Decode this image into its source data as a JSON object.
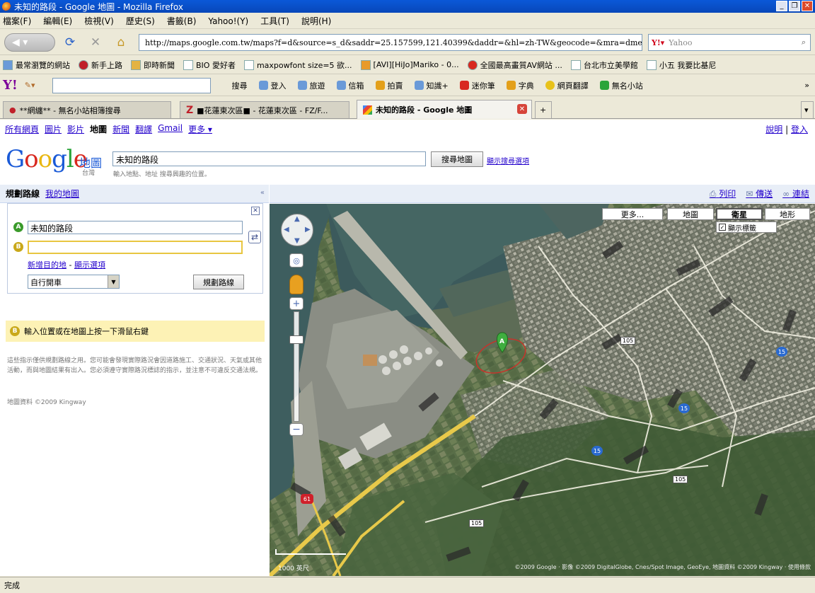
{
  "window": {
    "title": "未知的路段 - Google 地圖 - Mozilla Firefox"
  },
  "menu": [
    "檔案(F)",
    "編輯(E)",
    "檢視(V)",
    "歷史(S)",
    "書籤(B)",
    "Yahoo!(Y)",
    "工具(T)",
    "說明(H)"
  ],
  "nav": {
    "back_label": "◀ ▾",
    "url": "http://maps.google.com.tw/maps?f=d&source=s_d&saddr=25.157599,121.40399&daddr=&hl=zh-TW&geocode=&mra=dme&mrsp=0&sz",
    "search_placeholder": "Yahoo"
  },
  "bookmarks": [
    "最常瀏覽的網站",
    "新手上路",
    "即時新聞",
    "BIO 愛好者",
    "maxpowfont size=5 欲...",
    "[AVI][HiJo]Mariko - 0...",
    "全國最高畫質AV網站 ...",
    "台北市立美學館",
    "小五 我要比基尼"
  ],
  "yahoo_toolbar": [
    "搜尋",
    "登入",
    "旅遊",
    "信箱",
    "拍賣",
    "知識+",
    "迷你筆",
    "字典",
    "網頁翻譯",
    "無名小站"
  ],
  "tabs": [
    {
      "label": "**網纏** - 無名小站相簿搜尋"
    },
    {
      "label": "■花蓮東次區■ - 花蓮東次區 - FZ/F..."
    },
    {
      "label": "未知的路段 - Google 地圖"
    }
  ],
  "gbar": {
    "links": [
      "所有網頁",
      "圖片",
      "影片"
    ],
    "current": "地圖",
    "more_links": [
      "新聞",
      "翻譯",
      "Gmail",
      "更多 ▾"
    ],
    "help": "說明",
    "login": "登入"
  },
  "search": {
    "query": "未知的路段",
    "hint": "輸入地點、地址 搜尋興趣的位置。",
    "button": "搜尋地圖",
    "options": "顯示搜尋選項",
    "maps_word": "地圖",
    "country": "台灣"
  },
  "panel": {
    "tab_directions": "規劃路線",
    "tab_mymaps": "我的地圖",
    "from_value": "未知的路段",
    "to_value": "",
    "add_destination": "新增目的地",
    "show_options": "顯示選項",
    "mode": "自行開車",
    "plan_button": "規劃路線",
    "b_note": "輸入位置或在地圖上按一下滑鼠右鍵",
    "disclaimer": "這些指示僅供規劃路線之用。您可能會發現實際路況會因道路施工、交通狀況、天氣或其他活動，而與地圖結果有出入。您必須遵守實際路況標誌的指示，並注意不可違反交通法規。",
    "credit": "地圖資料 ©2009 Kingway"
  },
  "map": {
    "print": "列印",
    "send": "傳送",
    "link": "連結",
    "more": "更多...",
    "type_map": "地圖",
    "type_satellite": "衛星",
    "type_terrain": "地形",
    "show_labels": "顯示標籤",
    "scale_text": "1000 英尺",
    "copyright": "©2009 Google · 影像 ©2009 DigitalGlobe, Cnes/Spot Image, GeoEye, 地圖資料 ©2009 Kingway · 使用條款",
    "road_labels": [
      "105",
      "105",
      "15",
      "15",
      "15",
      "61",
      "105"
    ]
  },
  "status": "完成"
}
